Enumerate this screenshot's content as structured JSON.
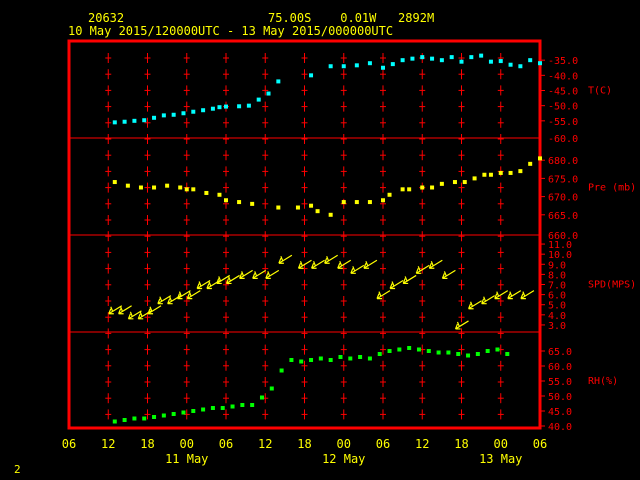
{
  "header": {
    "station": "20632",
    "location": "75.00S    0.01W   2892M",
    "period": "10 May 2015/120000UTC - 13 May 2015/000000UTC"
  },
  "page_number": "2",
  "colors": {
    "background": "#000000",
    "frame": "#ff0000",
    "tick": "#ff0000",
    "text": "#ffff00",
    "temperature": "#00ffff",
    "pressure": "#ffff00",
    "wind": "#ffff00",
    "rh": "#00ff00"
  },
  "chart_data": {
    "type": "scatter",
    "x_axis": {
      "tick_labels": [
        "06",
        "12",
        "18",
        "00",
        "06",
        "12",
        "18",
        "00",
        "06",
        "12",
        "18",
        "00",
        "06"
      ],
      "date_labels": [
        {
          "label": "11 May",
          "at_tick": 3
        },
        {
          "label": "12 May",
          "at_tick": 7
        },
        {
          "label": "13 May",
          "at_tick": 11
        }
      ],
      "range_hours": [
        -6,
        66
      ],
      "note": "x values are hours since 10 May 2015 12:00 UTC"
    },
    "panels": [
      {
        "name": "temperature",
        "label": "T(C)",
        "ylim": [
          -60,
          -30
        ],
        "ticks": [
          -55,
          -50,
          -45,
          -40,
          -35
        ],
        "tick_labels": [
          "-55.0",
          "-50.0",
          "-45.0",
          "-40.0",
          "-35.0"
        ],
        "extra_tick_label": "-60.0",
        "marker": "square",
        "x": [
          1,
          2.5,
          4,
          5.5,
          7,
          8.5,
          10,
          11.5,
          13,
          14.5,
          16,
          17,
          18,
          20,
          21.5,
          23,
          24.5,
          26,
          31,
          34,
          36,
          38,
          40,
          42,
          43.5,
          45,
          46.5,
          48,
          49.5,
          51,
          52.5,
          54,
          55.5,
          57,
          58.5,
          60
        ],
        "y": [
          -55.5,
          -55.3,
          -55,
          -54.8,
          -54,
          -53.2,
          -53,
          -52.5,
          -52,
          -51.5,
          -51,
          -50.5,
          -50.3,
          -50.2,
          -50,
          -48,
          -46,
          -42,
          -40,
          -37,
          -37,
          -36.7,
          -36,
          -37.5,
          -36.3,
          -35,
          -34.5,
          -34,
          -34.5,
          -35,
          -34,
          -35.5,
          -34,
          -33.5,
          -35.5,
          -35.3
        ],
        "x2": [
          61.5,
          63,
          64.5,
          66
        ],
        "y2": [
          -36.5,
          -37,
          -35,
          -36
        ]
      },
      {
        "name": "pressure",
        "label": "Pre (mb)",
        "ylim": [
          660,
          685
        ],
        "ticks": [
          665,
          670,
          675,
          680
        ],
        "tick_labels": [
          "665.0",
          "670.0",
          "675.0",
          "680.0"
        ],
        "extra_tick_label": "660.0",
        "marker": "square",
        "x": [
          1,
          3,
          5,
          7,
          9,
          11,
          12,
          13,
          15,
          17,
          18,
          19,
          21,
          23,
          26,
          28,
          30,
          32,
          33,
          35,
          36,
          37,
          39,
          41,
          43,
          45,
          46,
          48,
          50,
          51,
          53,
          55,
          57,
          58,
          60,
          62,
          64,
          66
        ],
        "y": [
          674,
          673,
          672.5,
          672.5,
          673,
          672.5,
          672,
          672,
          671,
          670.5,
          669,
          668.5,
          668,
          667,
          667,
          667.5,
          666,
          665,
          668.5,
          668.5,
          668.5,
          669,
          670.5,
          672,
          672,
          672.5,
          672.5,
          673.5,
          674,
          674,
          675,
          676,
          676,
          676.5,
          676.5,
          677,
          679,
          680.5
        ],
        "x_fix": [
          1,
          3,
          5,
          7,
          9,
          11,
          12,
          13,
          15,
          17,
          18,
          20,
          22,
          26,
          29,
          31,
          32,
          34,
          36,
          38,
          40,
          42,
          43,
          45,
          46,
          48,
          49.5,
          51,
          53,
          54.5,
          56,
          57.5,
          58.5,
          60,
          61.5,
          63,
          64.5,
          66
        ],
        "y_fix": [
          674,
          673,
          672.5,
          672.5,
          673,
          672.5,
          672,
          672,
          671,
          670.5,
          669,
          668.5,
          668,
          667,
          667,
          667.5,
          666,
          665,
          668.5,
          668.5,
          668.5,
          669,
          670.5,
          672,
          672,
          672.5,
          672.5,
          673.5,
          674,
          674,
          675,
          676,
          676,
          676.5,
          676.5,
          677,
          679,
          680.5
        ]
      },
      {
        "name": "wind_speed",
        "label": "SPD(MPS)",
        "ylim": [
          2.5,
          11.5
        ],
        "ticks": [
          3,
          4,
          5,
          6,
          7,
          8,
          9,
          10,
          11
        ],
        "tick_labels": [
          "3.0",
          "4.0",
          "5.0",
          "6.0",
          "7.0",
          "8.0",
          "9.0",
          "10.0",
          "11.0"
        ],
        "marker": "wind_arrow",
        "x": [
          1,
          2.5,
          4,
          5.5,
          7,
          8.5,
          10,
          11.5,
          13,
          14.5,
          16,
          17.5,
          19,
          21,
          23,
          25,
          27,
          30,
          32,
          34,
          36,
          38,
          40,
          42,
          44,
          46,
          48,
          50,
          52,
          54,
          56,
          58,
          60,
          62,
          64
        ],
        "y": [
          4.5,
          4.5,
          4.0,
          4.0,
          4.5,
          5.5,
          5.5,
          6.0,
          6.0,
          7.0,
          7.0,
          7.5,
          7.5,
          8.0,
          8.0,
          8.0,
          9.5,
          9.0,
          9.0,
          9.5,
          9.0,
          8.5,
          9.0,
          6.0,
          7.0,
          7.5,
          8.5,
          9.0,
          8.0,
          3.0,
          5.0,
          5.5,
          6.0,
          6.0,
          6.0
        ]
      },
      {
        "name": "rh",
        "label": "RH(%)",
        "ylim": [
          40,
          70
        ],
        "ticks": [
          40,
          45,
          50,
          55,
          60,
          65
        ],
        "tick_labels": [
          "40.0",
          "45.0",
          "50.0",
          "55.0",
          "60.0",
          "65.0"
        ],
        "marker": "square",
        "x": [
          1,
          2.5,
          4,
          5.5,
          7,
          8.5,
          10,
          11.5,
          13,
          14.5,
          16,
          17.5,
          19,
          20.5,
          22,
          23.5,
          25,
          26.5,
          28,
          29.5,
          31,
          32.5,
          34,
          35.5,
          37,
          38.5,
          40,
          41.5,
          43,
          44.5,
          46,
          47.5,
          49,
          50.5,
          52,
          53.5,
          55,
          56.5,
          58,
          59.5,
          61
        ],
        "y": [
          41.5,
          42,
          42.5,
          42.5,
          43,
          43.5,
          44,
          44.5,
          45,
          45.5,
          46,
          46,
          46.5,
          47,
          47,
          49.5,
          52.5,
          58.5,
          62,
          61.5,
          62,
          62.5,
          62,
          63,
          62.5,
          63,
          62.5,
          64,
          65,
          65.5,
          66,
          65.5,
          65,
          64.5,
          64.5,
          64,
          63.5,
          64,
          65,
          65.5,
          64,
          63
        ]
      }
    ]
  }
}
